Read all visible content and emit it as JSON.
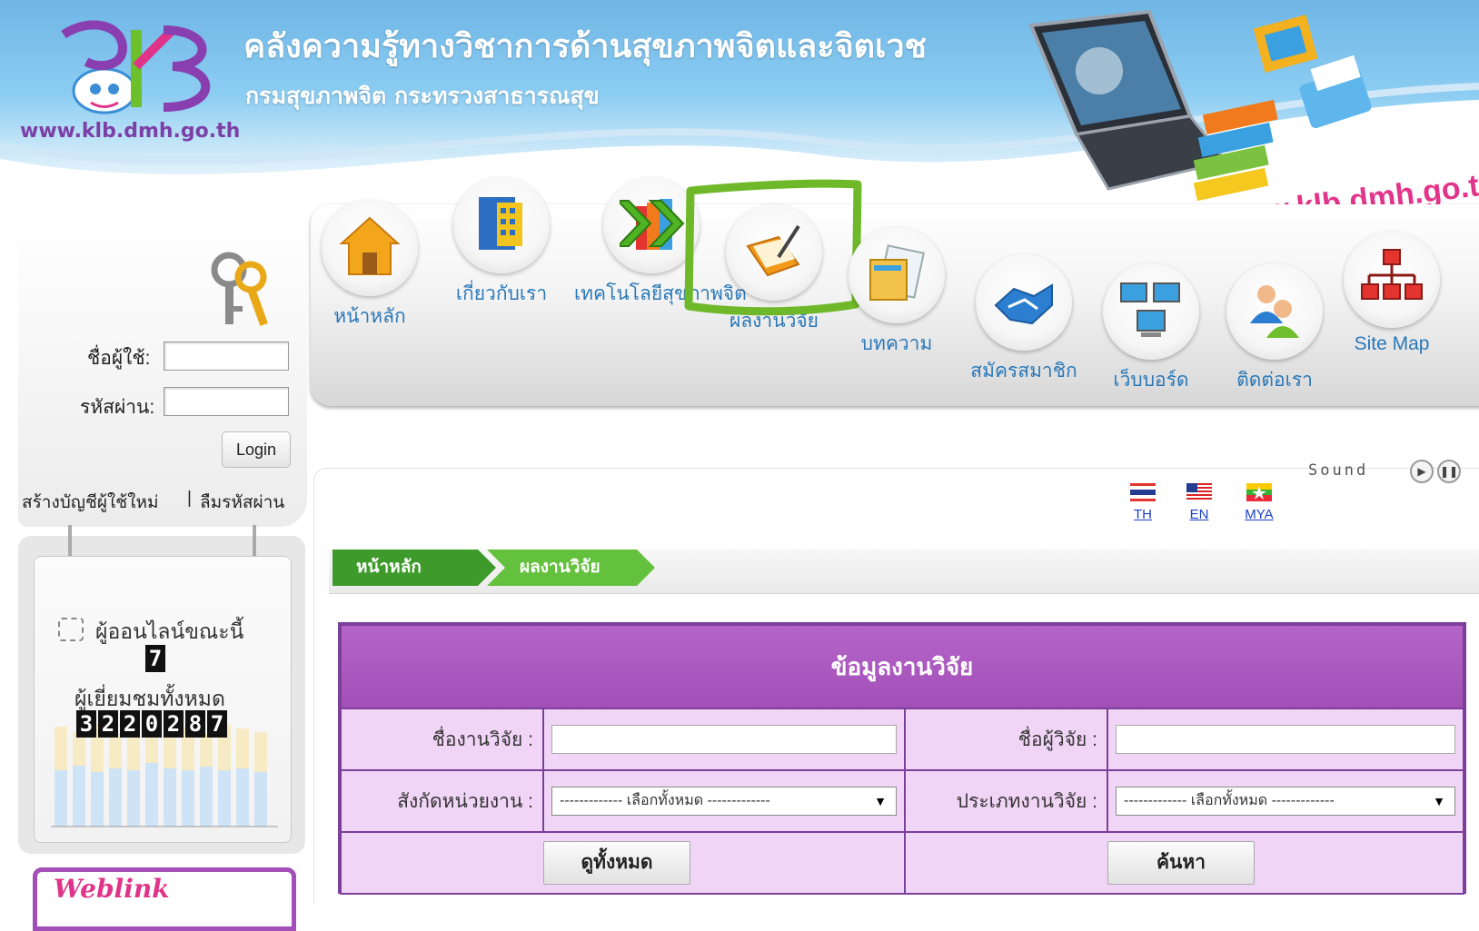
{
  "header": {
    "site_title": "คลังความรู้ทางวิชาการด้านสุขภาพจิตและจิตเวช",
    "site_subtitle": "กรมสุขภาพจิต กระทรวงสาธารณสุข",
    "logo_text": "KLB",
    "logo_url": "www.klb.dmh.go.th",
    "welcome_text": "Welcome to www.klb.dmh.go.th"
  },
  "nav": {
    "items": [
      {
        "label": "หน้าหลัก",
        "icon": "home-icon"
      },
      {
        "label": "เกี่ยวกับเรา",
        "icon": "book-icon"
      },
      {
        "label": "เทคโนโลยีสุขภาพจิต",
        "icon": "arrow-books-icon"
      },
      {
        "label": "ผลงานวิจัย",
        "icon": "research-icon"
      },
      {
        "label": "บทความ",
        "icon": "article-icon"
      },
      {
        "label": "สมัครสมาชิก",
        "icon": "handshake-icon"
      },
      {
        "label": "เว็บบอร์ด",
        "icon": "computers-icon"
      },
      {
        "label": "ติดต่อเรา",
        "icon": "people-icon"
      },
      {
        "label": "Site Map",
        "icon": "sitemap-icon"
      }
    ]
  },
  "login": {
    "username_label": "ชื่อผู้ใช้:",
    "password_label": "รหัสผ่าน:",
    "login_button": "Login",
    "register_link": "สร้างบัญชีผู้ใช้ใหม่",
    "separator": "|",
    "forgot_link": "ลืมรหัสผ่าน"
  },
  "stats": {
    "online_label": "ผู้ออนไลน์ขณะนี้",
    "online_count": "7",
    "visitors_label": "ผู้เยี่ยมชมทั้งหมด",
    "visitors_digits": [
      "3",
      "2",
      "2",
      "0",
      "2",
      "8",
      "7"
    ]
  },
  "weblink_label": "Weblink",
  "sound": {
    "label": "Sound"
  },
  "languages": [
    {
      "code": "TH"
    },
    {
      "code": "EN"
    },
    {
      "code": "MYA"
    }
  ],
  "breadcrumb": {
    "home": "หน้าหลัก",
    "current": "ผลงานวิจัย"
  },
  "form": {
    "title": "ข้อมูลงานวิจัย",
    "research_name_label": "ชื่องานวิจัย :",
    "researcher_label": "ชื่อผู้วิจัย :",
    "affiliation_label": "สังกัดหน่วยงาน :",
    "type_label": "ประเภทงานวิจัย :",
    "affiliation_value": "------------- เลือกทั้งหมด -------------",
    "type_value": "------------- เลือกทั้งหมด -------------",
    "view_all_button": "ดูทั้งหมด",
    "search_button": "ค้นหา"
  },
  "colors": {
    "form_purple": "#a24fb7",
    "form_light": "#f1d5f6",
    "crumb_green": "#5ab83a",
    "nav_text": "#2a78b8",
    "highlight_green": "#6fb82a"
  }
}
